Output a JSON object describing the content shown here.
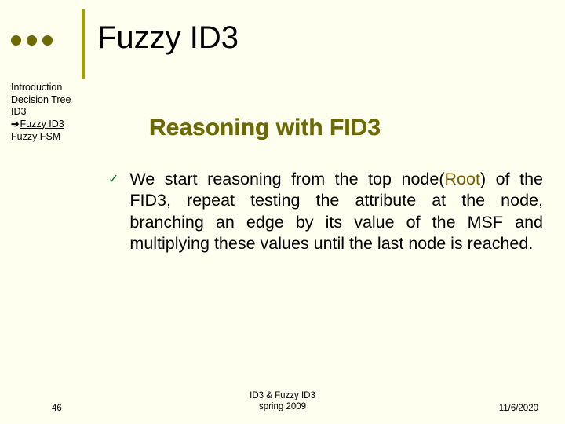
{
  "title": "Fuzzy ID3",
  "nav": {
    "items": [
      {
        "label": "Introduction"
      },
      {
        "label": "Decision Tree"
      },
      {
        "label": "ID3"
      },
      {
        "label": "Fuzzy ID3",
        "current": true
      },
      {
        "label": "Fuzzy FSM"
      }
    ],
    "arrow_glyph": "➔"
  },
  "subtitle": "Reasoning with FID3",
  "bullet": {
    "check_glyph": "✓",
    "text_pre": "We start reasoning from the top node(",
    "root_word": "Root",
    "text_post": ") of the FID3, repeat testing the attribute at the node, branching an edge by its value of the MSF and multiplying these values until the last node is reached."
  },
  "footer": {
    "page": "46",
    "center_line1": "ID3 & Fuzzy ID3",
    "center_line2": "spring 2009",
    "date": "11/6/2020"
  }
}
